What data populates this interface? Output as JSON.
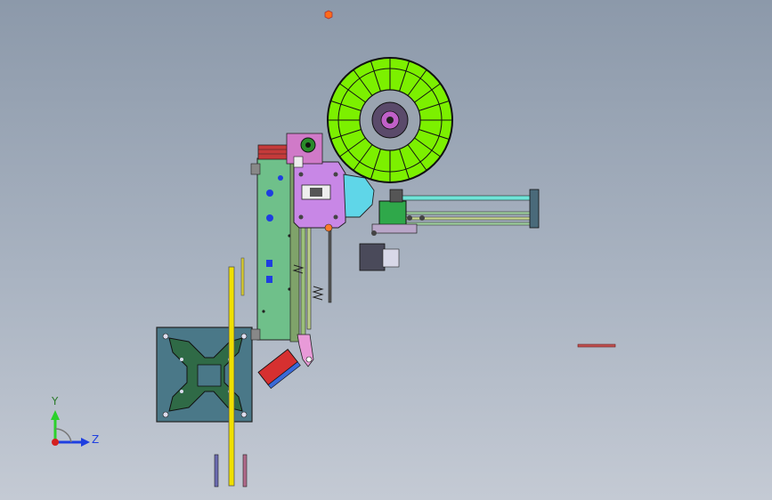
{
  "viewport": {
    "background_top": "#8c99aa",
    "background_bottom": "#c4cad4"
  },
  "triad": {
    "y_label": "Y",
    "z_label": "Z",
    "y_color": "#2bd12b",
    "z_color": "#1f3fe0",
    "x_color": "#d42020"
  },
  "model": {
    "spool_color": "#7cf000",
    "frame_color": "#6fc08a",
    "bracket_color": "#c887e6",
    "bed_color": "#4a7888",
    "rail_color": "#f0e000",
    "accent_color": "#d63030"
  }
}
